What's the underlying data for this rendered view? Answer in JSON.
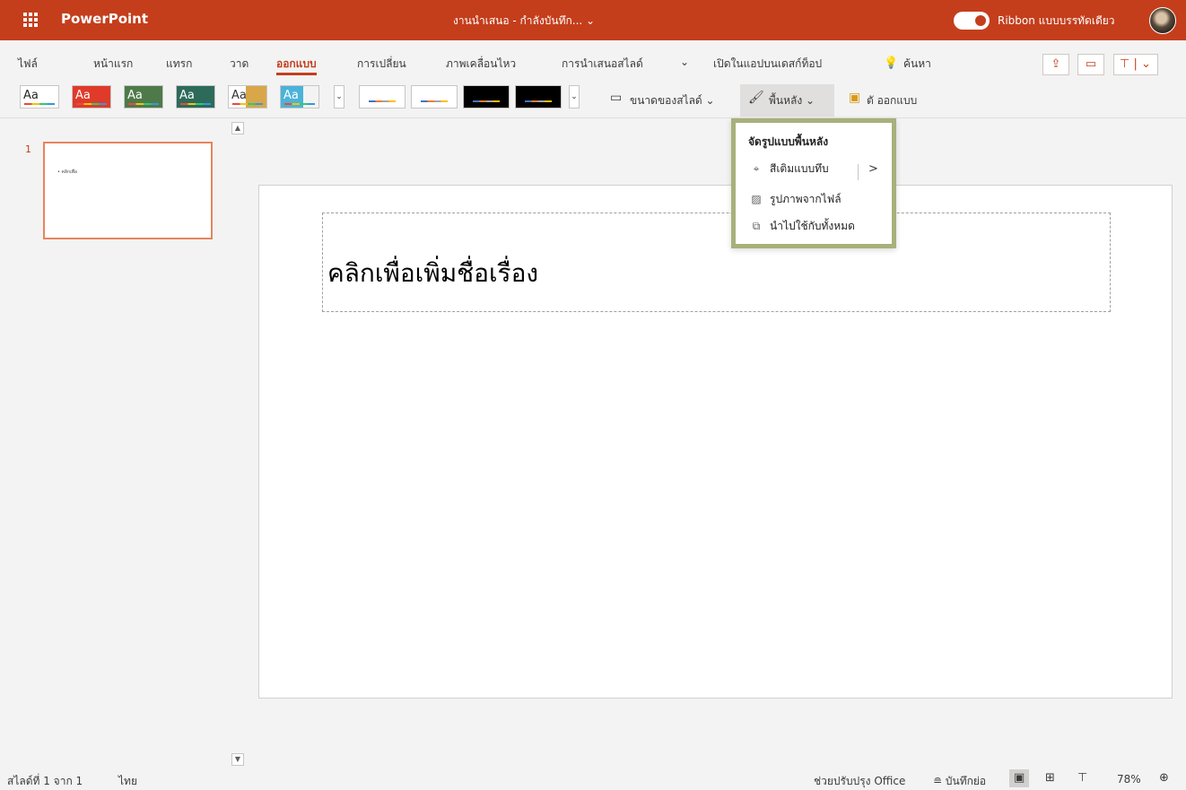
{
  "titlebar": {
    "app_name": "PowerPoint",
    "document_title": "งานนำเสนอ - กำลังบันทึก... ⌄",
    "ribbon_toggle_label": "Ribbon แบบบรรทัดเดียว"
  },
  "tabs": {
    "items": [
      "ไฟล์",
      "หน้าแรก",
      "แทรก",
      "วาด",
      "ออกแบบ",
      "การเปลี่ยน",
      "ภาพเคลื่อนไหว",
      "การนำเสนอสไลด์",
      "⌄",
      "เปิดในแอปบนเดสก์ท็อป"
    ],
    "active": "ออกแบบ",
    "search_label": "ค้นหา"
  },
  "ribbon": {
    "theme_label": "Aa",
    "slide_size_label": "ขนาดของสไลด์ ⌄",
    "background_label": "พื้นหลัง ⌄",
    "designer_label": "ตั ออกแบบ"
  },
  "menu": {
    "header": "จัดรูปแบบพื้นหลัง",
    "items": [
      {
        "label": "สีเติมแบบทึบ",
        "icon": "paint-bucket-icon"
      },
      {
        "label": "รูปภาพจากไฟล์",
        "icon": "picture-icon"
      },
      {
        "label": "นำไปใช้กับทั้งหมด",
        "icon": "apply-all-icon"
      }
    ],
    "submenu_arrow": ">"
  },
  "thumbnails": {
    "slide_number": "1",
    "thumb_text": "• คลิกเพื่อ"
  },
  "slide": {
    "title_placeholder": "คลิกเพื่อเพิ่มชื่อเรื่อง"
  },
  "statusbar": {
    "slide_info": "สไลด์ที่ 1 จาก 1",
    "language": "ไทย",
    "feedback": "ช่วยปรับปรุง Office",
    "notes": "≘ บันทึกย่อ",
    "zoom": "78%"
  },
  "colors": {
    "brand": "#c43e1c",
    "highlight_border": "#a8b07a"
  }
}
